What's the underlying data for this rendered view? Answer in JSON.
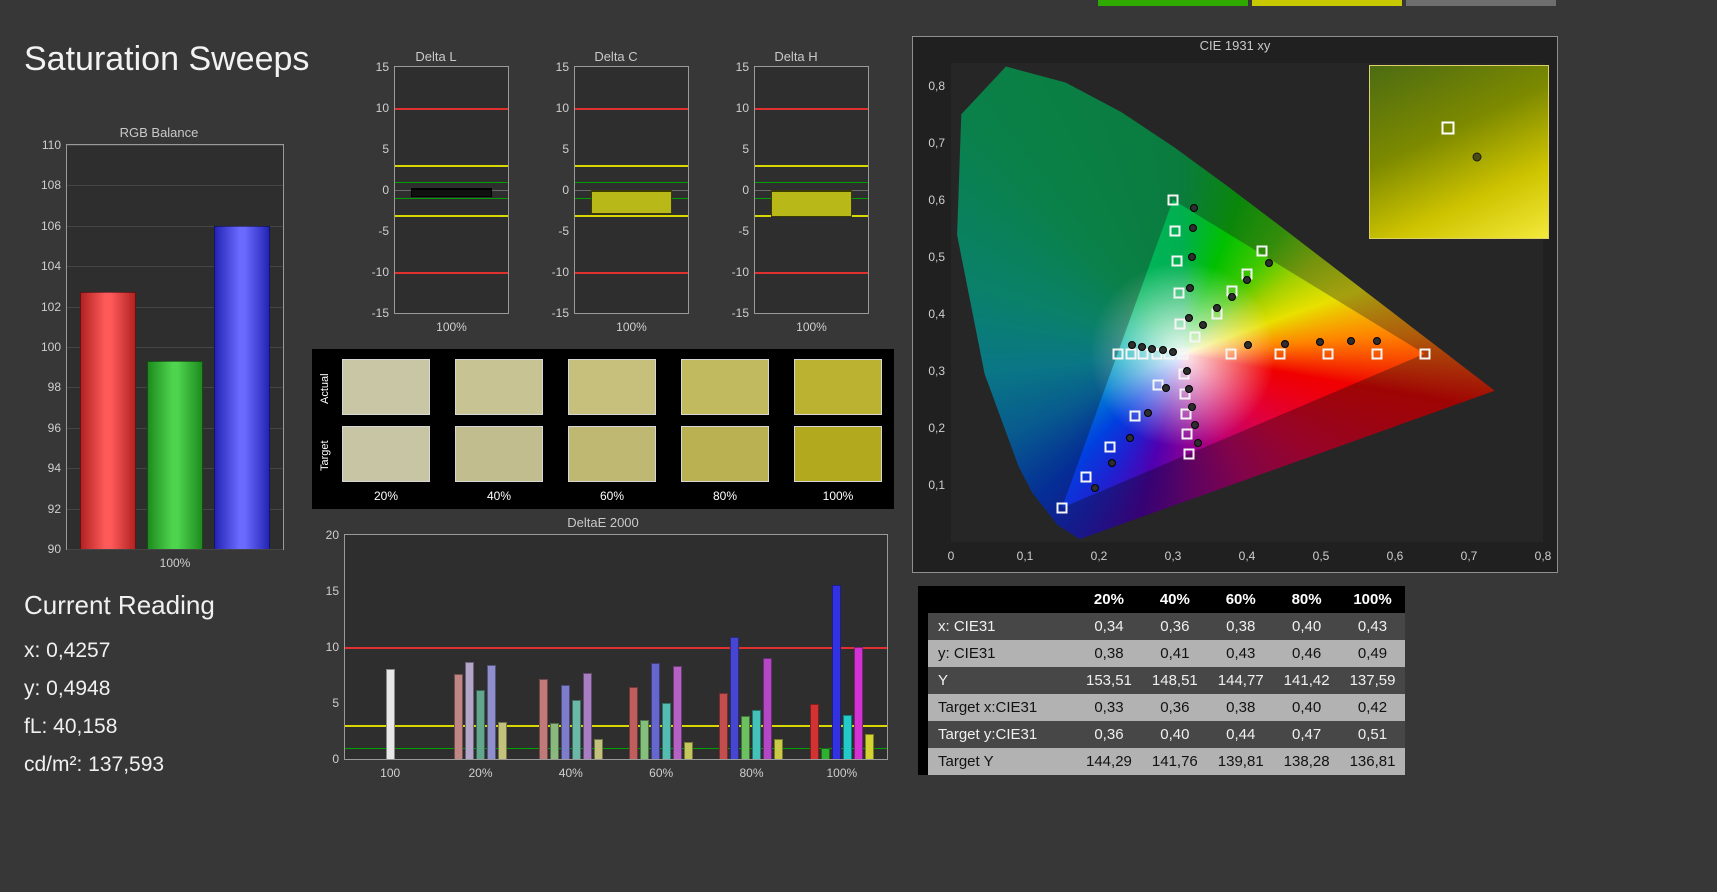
{
  "page": {
    "title": "Saturation Sweeps"
  },
  "top_tabs": [
    {
      "color": "#2fa800"
    },
    {
      "color": "#c8c800"
    },
    {
      "color": "#6e6e6e"
    }
  ],
  "limits": {
    "red": "#e03131",
    "yellow": "#d8d800",
    "green": "#00a000"
  },
  "rgb_balance": {
    "title": "RGB Balance",
    "ymin": 90,
    "ymax": 110,
    "y_ticks": [
      110,
      108,
      106,
      104,
      102,
      100,
      98,
      96,
      94,
      92,
      90
    ],
    "x_label": "100%",
    "bars": [
      {
        "name": "red",
        "value": 102.7,
        "color_mid": "#ff5a5a",
        "color_edge": "#b22222"
      },
      {
        "name": "green",
        "value": 99.3,
        "color_mid": "#4ed44e",
        "color_edge": "#1e8c1e"
      },
      {
        "name": "blue",
        "value": 106.0,
        "color_mid": "#6a6aff",
        "color_edge": "#2424b4"
      }
    ]
  },
  "current_reading": {
    "title": "Current Reading",
    "lines": [
      "x: 0,4257",
      "y: 0,4948",
      "fL: 40,158",
      "cd/m²: 137,593"
    ]
  },
  "delta_charts": {
    "ymin": -15,
    "ymax": 15,
    "y_ticks": [
      15,
      10,
      5,
      0,
      -5,
      -10,
      -15
    ],
    "x_label": "100%",
    "charts": [
      {
        "title": "Delta L",
        "bar_from": 0.3,
        "bar_to": -0.8,
        "bar_color": "#101010",
        "bar_border": "#000000"
      },
      {
        "title": "Delta C",
        "bar_from": 0.0,
        "bar_to": -2.9,
        "bar_color": "#b8b818",
        "bar_border": "#3c3c00"
      },
      {
        "title": "Delta H",
        "bar_from": 0.0,
        "bar_to": -3.3,
        "bar_color": "#b8b818",
        "bar_border": "#3c3c00"
      }
    ]
  },
  "swatches": {
    "row_labels": [
      "Actual",
      "Target"
    ],
    "col_labels": [
      "20%",
      "40%",
      "60%",
      "80%",
      "100%"
    ],
    "actual": [
      "#c9c6a6",
      "#c8c392",
      "#c6c07c",
      "#c2ba5e",
      "#bcb232"
    ],
    "target": [
      "#c8c5a5",
      "#c2bd8e",
      "#bfb873",
      "#bab153",
      "#b3a91f"
    ]
  },
  "deltae_chart": {
    "title": "DeltaE 2000",
    "ymin": 0,
    "ymax": 20,
    "y_ticks": [
      20,
      15,
      10,
      5,
      0
    ],
    "limit_lines": [
      {
        "value": 10,
        "color": "#e03131",
        "thickness": 2
      },
      {
        "value": 3,
        "color": "#d8d800",
        "thickness": 2
      },
      {
        "value": 1,
        "color": "#00a000",
        "thickness": 1
      }
    ],
    "groups": [
      {
        "label": "100",
        "bars": [
          {
            "color": "#e8e8e8",
            "value": 8.0
          }
        ]
      },
      {
        "label": "20%",
        "bars": [
          {
            "color": "#c08585",
            "value": 7.6
          },
          {
            "color": "#b3a6c9",
            "value": 8.7
          },
          {
            "color": "#63a68e",
            "value": 6.2
          },
          {
            "color": "#8f8fcd",
            "value": 8.4
          },
          {
            "color": "#c2c27c",
            "value": 3.3
          }
        ]
      },
      {
        "label": "40%",
        "bars": [
          {
            "color": "#c07a7a",
            "value": 7.1
          },
          {
            "color": "#8ab87e",
            "value": 3.2
          },
          {
            "color": "#7d7dcb",
            "value": 6.6
          },
          {
            "color": "#6cb8a8",
            "value": 5.3
          },
          {
            "color": "#a87ec2",
            "value": 7.7
          },
          {
            "color": "#c2c27c",
            "value": 1.8
          }
        ]
      },
      {
        "label": "60%",
        "bars": [
          {
            "color": "#c05e5e",
            "value": 6.4
          },
          {
            "color": "#84c07c",
            "value": 3.5
          },
          {
            "color": "#6666cf",
            "value": 8.6
          },
          {
            "color": "#55bcb2",
            "value": 5.0
          },
          {
            "color": "#b562c4",
            "value": 8.3
          },
          {
            "color": "#c6c65e",
            "value": 1.5
          }
        ]
      },
      {
        "label": "80%",
        "bars": [
          {
            "color": "#c44d4d",
            "value": 5.9
          },
          {
            "color": "#4646d2",
            "value": 10.9
          },
          {
            "color": "#6cc062",
            "value": 3.8
          },
          {
            "color": "#44c2ba",
            "value": 4.4
          },
          {
            "color": "#b347c4",
            "value": 9.0
          },
          {
            "color": "#caca46",
            "value": 1.8
          }
        ]
      },
      {
        "label": "100%",
        "bars": [
          {
            "color": "#d23232",
            "value": 4.9
          },
          {
            "color": "#30b030",
            "value": 1.0
          },
          {
            "color": "#3232e2",
            "value": 15.5
          },
          {
            "color": "#22caca",
            "value": 3.9
          },
          {
            "color": "#d232d2",
            "value": 10.0
          },
          {
            "color": "#d2d232",
            "value": 2.2
          }
        ]
      }
    ]
  },
  "cie": {
    "title": "CIE 1931 xy",
    "x_max": 0.8,
    "y_max": 0.84,
    "x_ticks": [
      "0",
      "0,1",
      "0,2",
      "0,3",
      "0,4",
      "0,5",
      "0,6",
      "0,7",
      "0,8"
    ],
    "y_ticks": [
      "0,8",
      "0,7",
      "0,6",
      "0,5",
      "0,4",
      "0,3",
      "0,2",
      "0,1"
    ],
    "locus": [
      [
        0.1741,
        0.005
      ],
      [
        0.144,
        0.0297
      ],
      [
        0.1096,
        0.0868
      ],
      [
        0.0913,
        0.1327
      ],
      [
        0.0454,
        0.295
      ],
      [
        0.0082,
        0.5384
      ],
      [
        0.0139,
        0.7502
      ],
      [
        0.0743,
        0.8338
      ],
      [
        0.1547,
        0.8059
      ],
      [
        0.2296,
        0.7543
      ],
      [
        0.3016,
        0.6923
      ],
      [
        0.3731,
        0.6245
      ],
      [
        0.4441,
        0.5547
      ],
      [
        0.5125,
        0.4866
      ],
      [
        0.5752,
        0.4242
      ],
      [
        0.627,
        0.3725
      ],
      [
        0.6658,
        0.334
      ],
      [
        0.6915,
        0.3083
      ],
      [
        0.7079,
        0.292
      ],
      [
        0.7347,
        0.2653
      ]
    ],
    "gamut_triangle": [
      [
        0.64,
        0.33
      ],
      [
        0.3,
        0.6
      ],
      [
        0.15,
        0.06
      ]
    ],
    "targets": [
      [
        0.313,
        0.329
      ],
      [
        0.378,
        0.329
      ],
      [
        0.444,
        0.329
      ],
      [
        0.509,
        0.33
      ],
      [
        0.575,
        0.33
      ],
      [
        0.64,
        0.33
      ],
      [
        0.31,
        0.383
      ],
      [
        0.308,
        0.437
      ],
      [
        0.305,
        0.492
      ],
      [
        0.303,
        0.546
      ],
      [
        0.3,
        0.6
      ],
      [
        0.28,
        0.275
      ],
      [
        0.248,
        0.221
      ],
      [
        0.215,
        0.167
      ],
      [
        0.183,
        0.114
      ],
      [
        0.15,
        0.06
      ],
      [
        0.33,
        0.36
      ],
      [
        0.36,
        0.4
      ],
      [
        0.38,
        0.44
      ],
      [
        0.4,
        0.47
      ],
      [
        0.42,
        0.51
      ],
      [
        0.295,
        0.329
      ],
      [
        0.278,
        0.329
      ],
      [
        0.26,
        0.329
      ],
      [
        0.243,
        0.329
      ],
      [
        0.225,
        0.329
      ],
      [
        0.315,
        0.294
      ],
      [
        0.316,
        0.259
      ],
      [
        0.318,
        0.224
      ],
      [
        0.319,
        0.189
      ],
      [
        0.321,
        0.154
      ]
    ],
    "measurements": [
      [
        0.402,
        0.345
      ],
      [
        0.452,
        0.348
      ],
      [
        0.498,
        0.35
      ],
      [
        0.54,
        0.352
      ],
      [
        0.576,
        0.353
      ],
      [
        0.322,
        0.392
      ],
      [
        0.323,
        0.446
      ],
      [
        0.325,
        0.5
      ],
      [
        0.327,
        0.55
      ],
      [
        0.329,
        0.586
      ],
      [
        0.291,
        0.27
      ],
      [
        0.266,
        0.226
      ],
      [
        0.242,
        0.182
      ],
      [
        0.218,
        0.138
      ],
      [
        0.195,
        0.095
      ],
      [
        0.34,
        0.38
      ],
      [
        0.36,
        0.41
      ],
      [
        0.38,
        0.43
      ],
      [
        0.4,
        0.46
      ],
      [
        0.43,
        0.49
      ],
      [
        0.3,
        0.333
      ],
      [
        0.286,
        0.336
      ],
      [
        0.272,
        0.339
      ],
      [
        0.258,
        0.342
      ],
      [
        0.245,
        0.345
      ],
      [
        0.319,
        0.3
      ],
      [
        0.322,
        0.268
      ],
      [
        0.326,
        0.236
      ],
      [
        0.33,
        0.205
      ],
      [
        0.334,
        0.174
      ]
    ],
    "inset": {
      "square": [
        0.44,
        0.36
      ],
      "dot": [
        0.6,
        0.53
      ]
    }
  },
  "data_table": {
    "columns": [
      "20%",
      "40%",
      "60%",
      "80%",
      "100%"
    ],
    "rows": [
      {
        "label": "x: CIE31",
        "values": [
          "0,34",
          "0,36",
          "0,38",
          "0,40",
          "0,43"
        ],
        "shade": "dark"
      },
      {
        "label": "y: CIE31",
        "values": [
          "0,38",
          "0,41",
          "0,43",
          "0,46",
          "0,49"
        ],
        "shade": "light"
      },
      {
        "label": "Y",
        "values": [
          "153,51",
          "148,51",
          "144,77",
          "141,42",
          "137,59"
        ],
        "shade": "dark"
      },
      {
        "label": "Target x:CIE31",
        "values": [
          "0,33",
          "0,36",
          "0,38",
          "0,40",
          "0,42"
        ],
        "shade": "light"
      },
      {
        "label": "Target y:CIE31",
        "values": [
          "0,36",
          "0,40",
          "0,44",
          "0,47",
          "0,51"
        ],
        "shade": "dark"
      },
      {
        "label": "Target Y",
        "values": [
          "144,29",
          "141,76",
          "139,81",
          "138,28",
          "136,81"
        ],
        "shade": "light"
      }
    ]
  }
}
